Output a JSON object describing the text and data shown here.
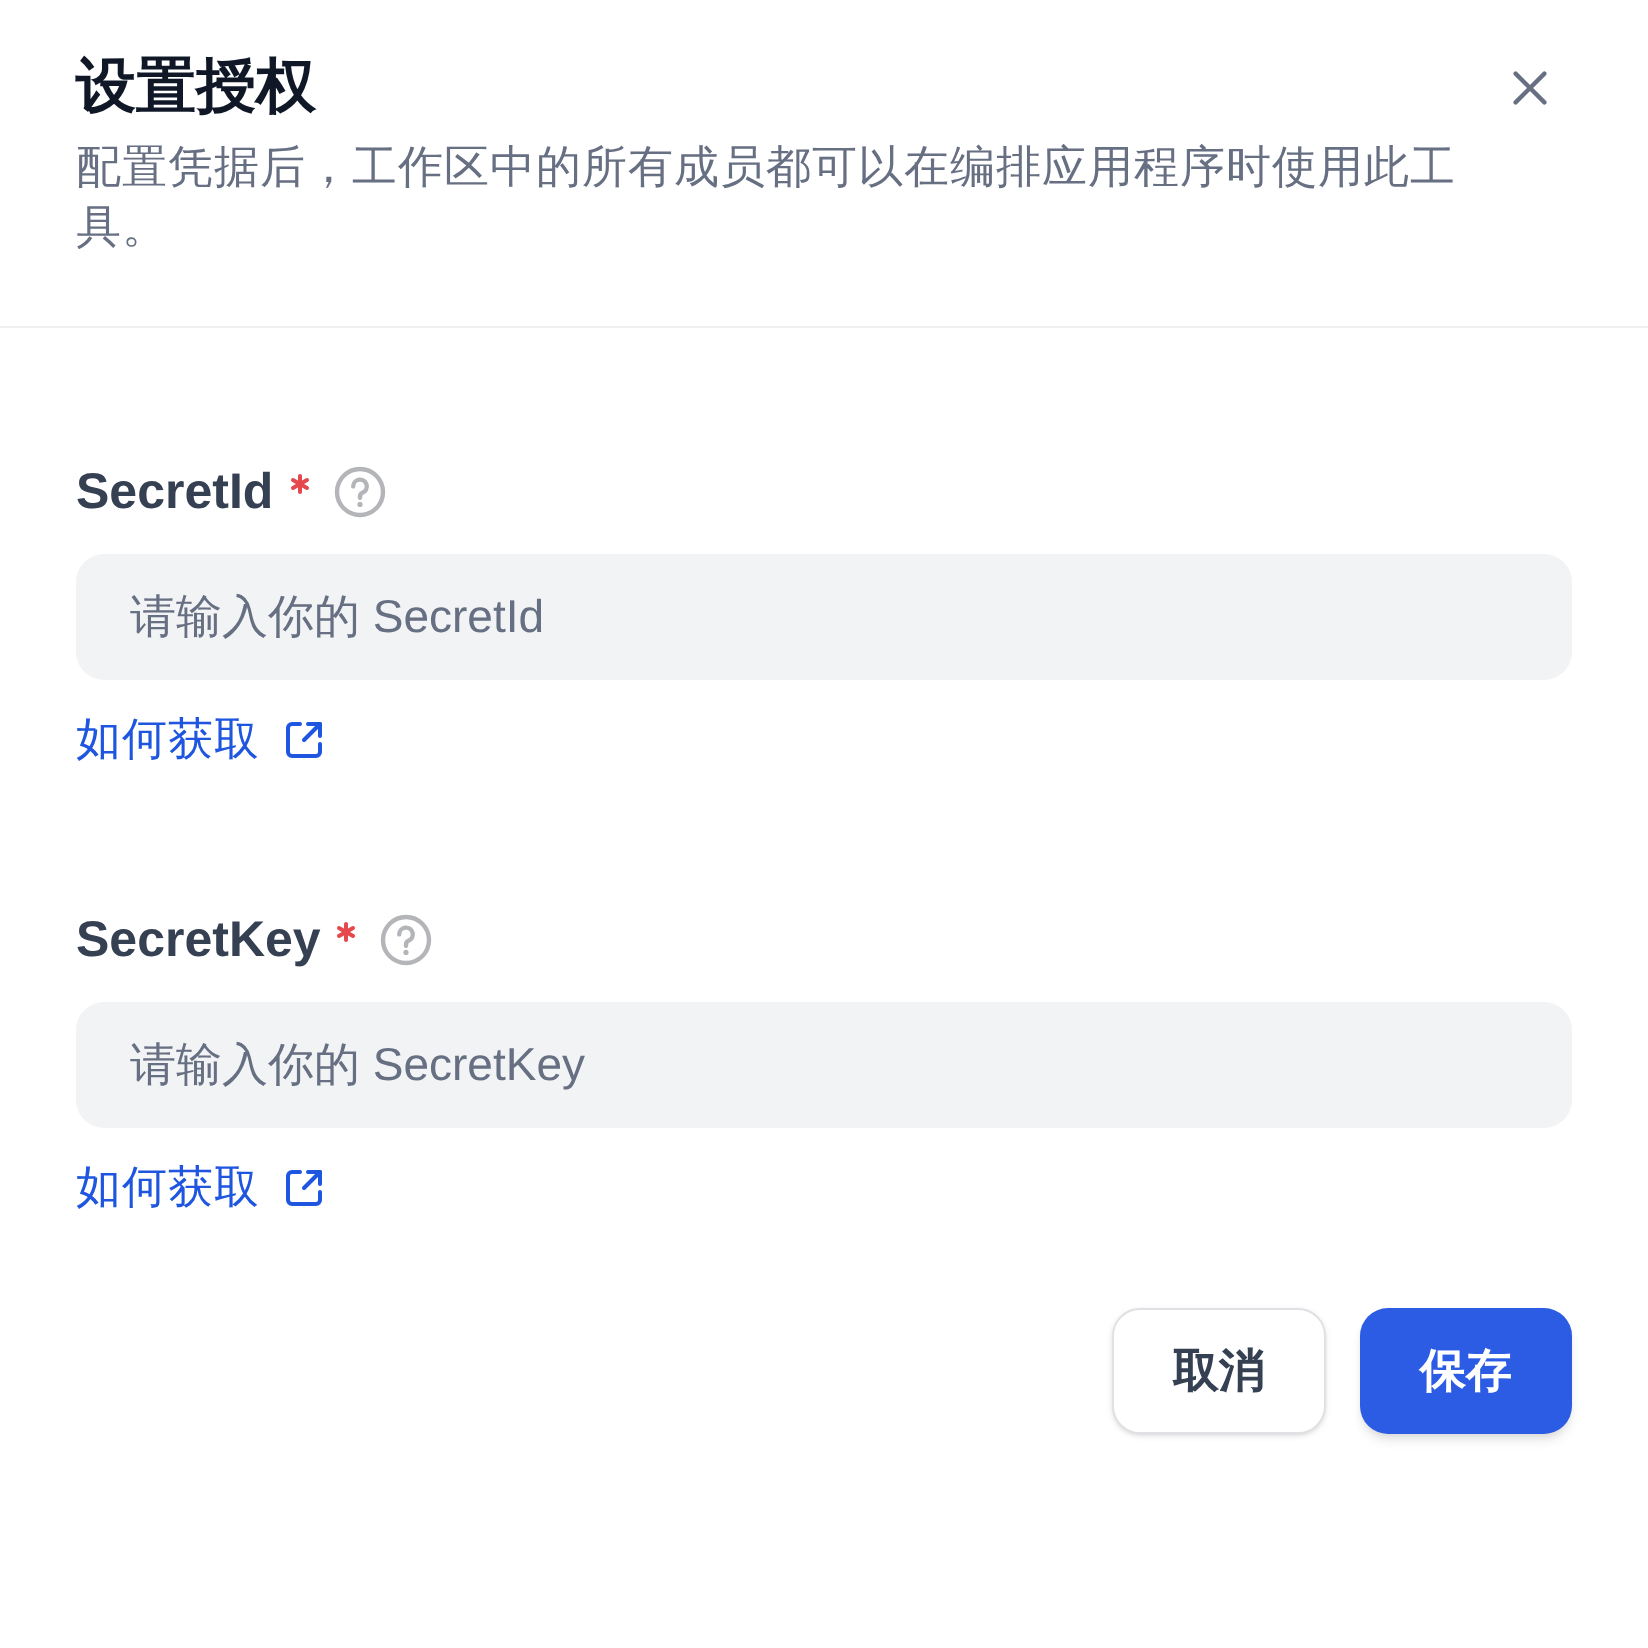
{
  "dialog": {
    "title": "设置授权",
    "description": "配置凭据后，工作区中的所有成员都可以在编排应用程序时使用此工具。"
  },
  "fields": [
    {
      "label": "SecretId",
      "required": true,
      "placeholder": "请输入你的 SecretId",
      "help_link": "如何获取"
    },
    {
      "label": "SecretKey",
      "required": true,
      "placeholder": "请输入你的 SecretKey",
      "help_link": "如何获取"
    }
  ],
  "buttons": [
    {
      "label": "取消",
      "kind": "secondary"
    },
    {
      "label": "保存",
      "kind": "primary"
    }
  ]
}
